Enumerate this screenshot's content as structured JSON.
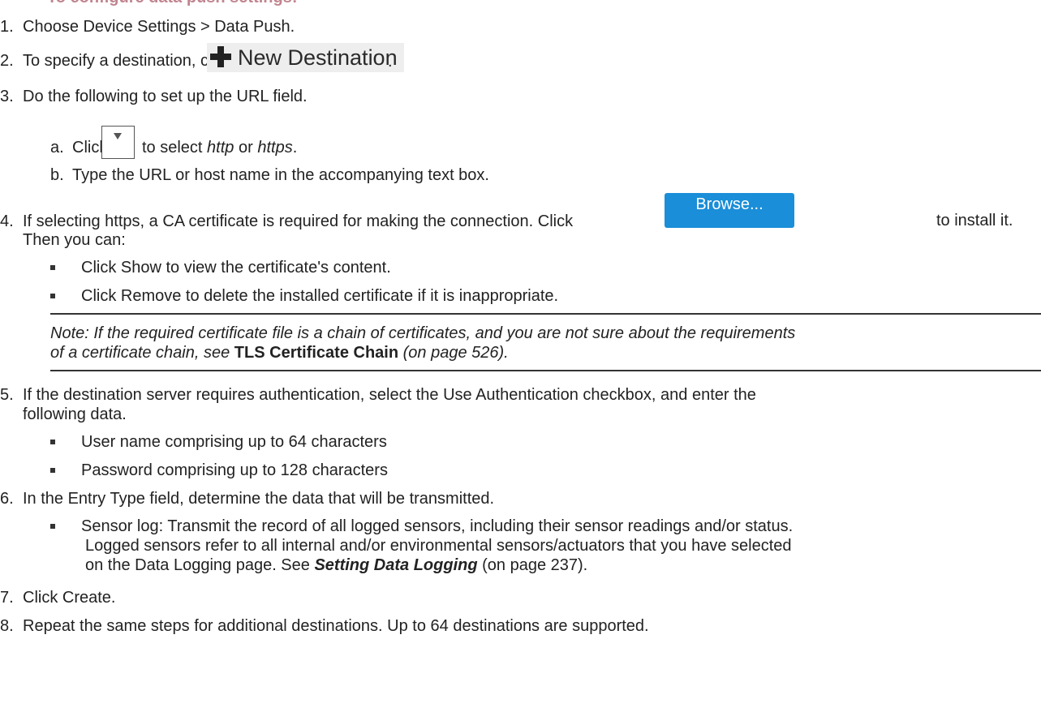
{
  "heading_partial": "To configure data push settings:",
  "steps": [
    {
      "num": "1.",
      "text": "Choose Device Settings > Data Push."
    },
    {
      "num": "2.",
      "text_before": "To specify a destination, click",
      "button": "New Destination",
      "text_after": "."
    },
    {
      "num": "3.",
      "text": "Do the following to set up the URL field."
    },
    {
      "num": "4.",
      "text_before": "If selecting https, a CA certificate is required for making the connection. Click",
      "button": "Browse...",
      "text_after": "to install it.",
      "text_line2": "Then you can:"
    },
    {
      "num": "5.",
      "text_line1": "If the destination server requires authentication, select the Use Authentication checkbox, and enter the",
      "text_line2": "following data."
    },
    {
      "num": "6.",
      "text": "In the Entry Type field, determine the data that will be transmitted."
    },
    {
      "num": "7.",
      "text": "Click Create."
    },
    {
      "num": "8.",
      "text": "Repeat the same steps for additional destinations. Up to 64 destinations are supported."
    }
  ],
  "step3_sub": {
    "a_label": "a.",
    "a_click": "Click",
    "a_mid": "to select",
    "a_http": "http",
    "a_or": "or",
    "a_https": "https",
    "a_end": ".",
    "b_label": "b.",
    "b_text": "Type the URL or host name in the accompanying text box."
  },
  "step4_bullets": [
    "Click Show to view the certificate's content.",
    "Click Remove to delete the installed certificate if it is inappropriate."
  ],
  "note": {
    "line1": "Note: If the required certificate file is a chain of certificates, and you are not sure about the requirements",
    "line2_before": "of a certificate chain, see",
    "link": "TLS Certificate Chain",
    "line2_after": "(on page 526)."
  },
  "step5_bullets": [
    "User name comprising up to 64 characters",
    "Password comprising up to 128 characters"
  ],
  "step6_bullet": {
    "line1": "Sensor log: Transmit the record of all logged sensors, including their sensor readings and/or status.",
    "line2": "Logged sensors refer to all internal and/or environmental sensors/actuators that you have selected",
    "line3_before": "on the Data Logging page. See",
    "link": "Setting Data Logging",
    "line3_after": "(on page 237)."
  }
}
